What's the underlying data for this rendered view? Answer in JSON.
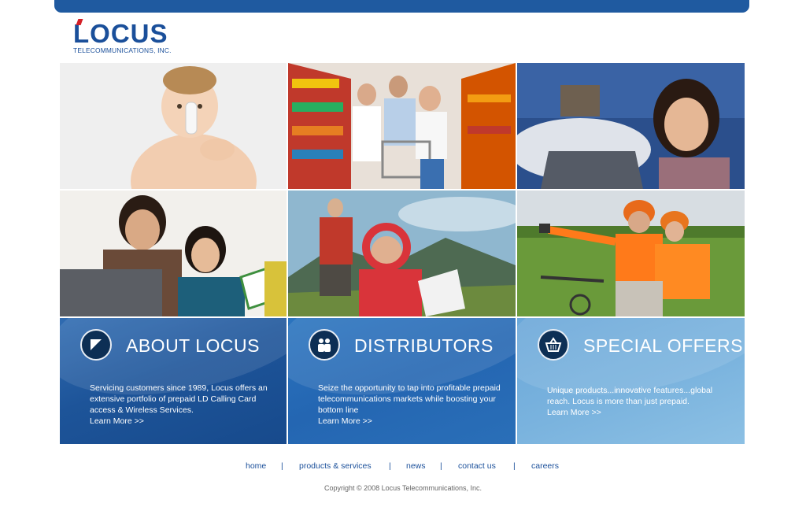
{
  "logo": {
    "name": "LOCUS",
    "subtitle": "TELECOMMUNICATIONS, INC."
  },
  "panels": [
    {
      "title": "ABOUT LOCUS",
      "text": "Servicing customers since 1989, Locus offers an extensive portfolio of prepaid LD Calling Card access & Wireless Services.",
      "link": "Learn More >>",
      "icon": "arrow-corner-icon"
    },
    {
      "title": "DISTRIBUTORS",
      "text": "Seize the opportunity to tap into profitable prepaid telecommunications markets while boosting your bottom line",
      "link": "Learn More >>",
      "icon": "people-icon"
    },
    {
      "title": "SPECIAL OFFERS",
      "text": "Unique products...innovative features...global reach.  Locus is more than just prepaid.",
      "link": "Learn More >>",
      "icon": "basket-icon"
    }
  ],
  "nav": {
    "items": [
      "home",
      "products & services",
      "news",
      "contact us",
      "careers"
    ],
    "separator": "|"
  },
  "footer": {
    "copyright": "Copyright © 2008 Locus Telecommunications, Inc."
  },
  "colors": {
    "brand_blue": "#1f5aa0",
    "logo_red": "#d42027"
  }
}
